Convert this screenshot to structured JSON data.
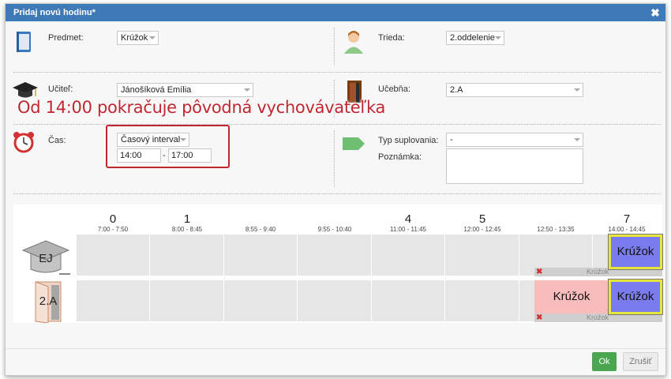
{
  "dialog": {
    "title": "Pridaj novú hodinu*",
    "close_label": "✖"
  },
  "fields": {
    "subject": {
      "label": "Predmet:",
      "value": "Krúžok"
    },
    "class": {
      "label": "Trieda:",
      "value": "2.oddelenie"
    },
    "teacher": {
      "label": "Učiteľ:",
      "value": "Jánošíková Emília"
    },
    "room": {
      "label": "Učebňa:",
      "value": "2.A"
    },
    "time": {
      "label": "Čas:",
      "mode": "Časový interval",
      "from": "14:00",
      "separator": "-",
      "to": "17:00"
    },
    "substitution": {
      "label": "Typ suplovania:",
      "value": "-"
    },
    "note": {
      "label": "Poznámka:",
      "value": ""
    }
  },
  "annotation": "Od 14:00 pokračuje pôvodná vychovávateľka",
  "timeline": {
    "columns": [
      {
        "num": "0",
        "time": "7:00 - 7:50"
      },
      {
        "num": "1",
        "time": "8:00 - 8:45"
      },
      {
        "num": "",
        "time": "8:55 - 9:40"
      },
      {
        "num": "",
        "time": "9:55 - 10:40"
      },
      {
        "num": "4",
        "time": "11:00 - 11:45"
      },
      {
        "num": "5",
        "time": "12:00 - 12:45"
      },
      {
        "num": "",
        "time": "12:50 - 13:35"
      },
      {
        "num": "7",
        "time": "14:00 - 14:45"
      }
    ],
    "rows": [
      {
        "label": "EJ"
      },
      {
        "label": "2.A"
      }
    ],
    "lessons": {
      "row1_new": "Krúžok",
      "row1_cancelled": "Krúžok",
      "row2_existing": "Krúžok",
      "row2_new": "Krúžok",
      "row2_cancelled": "Krúžok"
    }
  },
  "buttons": {
    "ok": "Ok",
    "cancel": "Zrušiť"
  },
  "colors": {
    "titlebar": "#3f7ab8",
    "lesson_new": "#7b7bf0",
    "lesson_highlight": "#e7e43a",
    "lesson_existing": "#f9bcbc",
    "annotation": "#c0262f",
    "ok_button": "#4aa64f"
  }
}
